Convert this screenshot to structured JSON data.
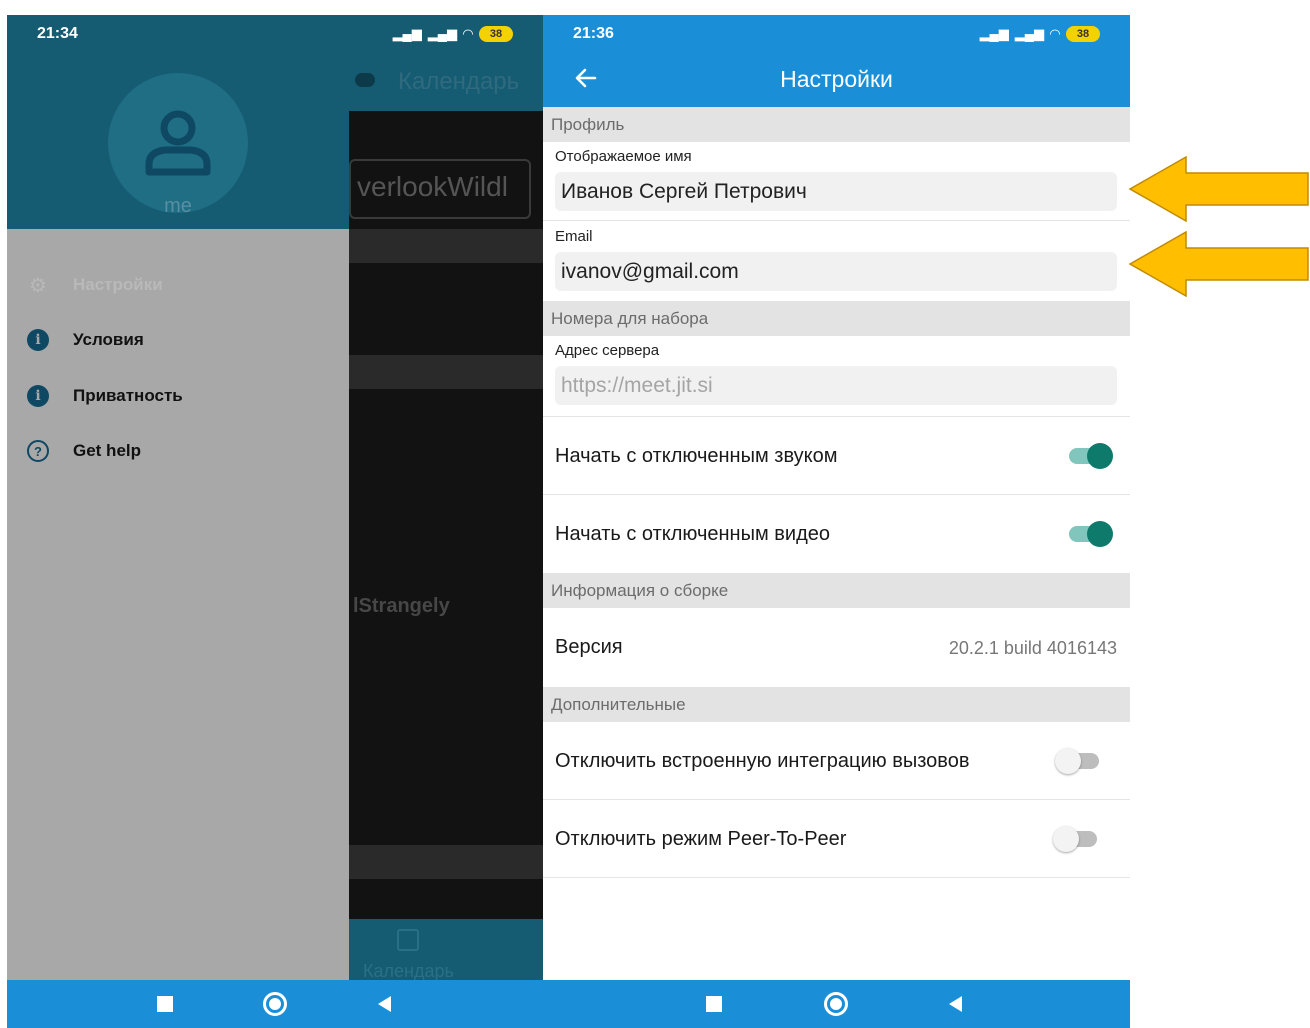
{
  "left": {
    "status": {
      "time": "21:34",
      "battery": "38"
    },
    "background_app": {
      "header_title": "Календарь",
      "input_text": "verlookWildl",
      "list_text": "lStrangely",
      "bottom_tab": "Календарь"
    },
    "drawer": {
      "username": "me",
      "items": [
        {
          "label": "Настройки",
          "icon": "gear-icon"
        },
        {
          "label": "Условия",
          "icon": "info-icon"
        },
        {
          "label": "Приватность",
          "icon": "info-icon"
        },
        {
          "label": "Get help",
          "icon": "help-icon"
        }
      ]
    }
  },
  "right": {
    "status": {
      "time": "21:36",
      "battery": "38"
    },
    "appbar": {
      "title": "Настройки"
    },
    "sections": {
      "profile": "Профиль",
      "dial": "Номера для набора",
      "build": "Информация о сборке",
      "extra": "Дополнительные"
    },
    "fields": {
      "display_name": {
        "label": "Отображаемое имя",
        "value": "Иванов Сергей Петрович"
      },
      "email": {
        "label": "Email",
        "value": "ivanov@gmail.com"
      },
      "server": {
        "label": "Адрес сервера",
        "placeholder": "https://meet.jit.si"
      }
    },
    "toggles": {
      "start_muted": {
        "label": "Начать с отключенным звуком",
        "on": true
      },
      "start_no_video": {
        "label": "Начать с отключенным видео",
        "on": true
      },
      "disable_call_integration": {
        "label": "Отключить встроенную интеграцию вызовов",
        "on": false
      },
      "disable_p2p": {
        "label": "Отключить режим Peer-To-Peer",
        "on": false
      }
    },
    "version": {
      "label": "Версия",
      "value": "20.2.1 build 4016143"
    }
  },
  "colors": {
    "app_blue": "#1a8fd8",
    "drawer_header": "#155c73",
    "toggle_on": "#0e7a6c",
    "arrow": "#ffbe00"
  }
}
